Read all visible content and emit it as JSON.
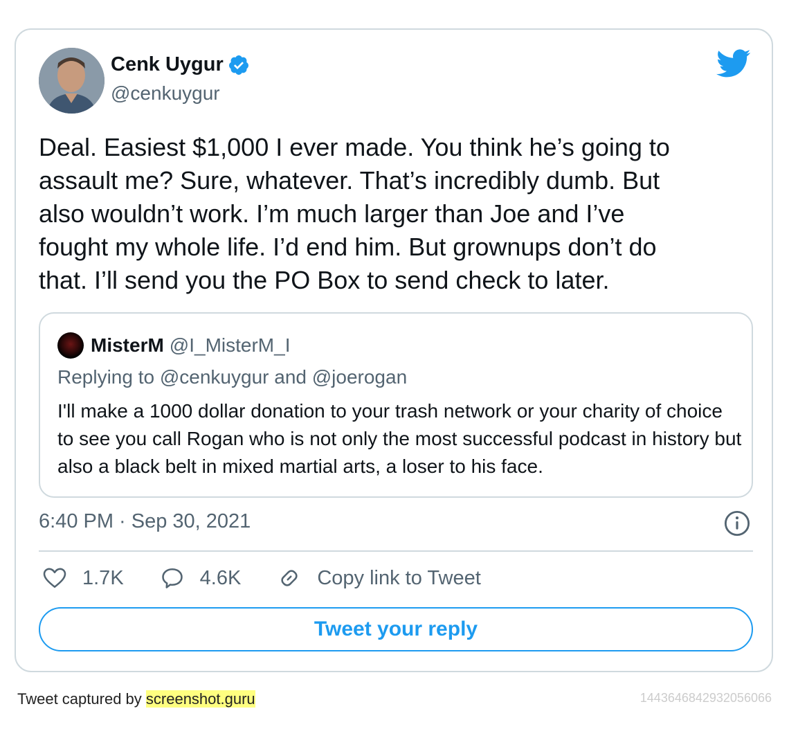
{
  "author": {
    "name": "Cenk Uygur",
    "handle": "@cenkuygur",
    "verified": true
  },
  "tweet": {
    "text": "Deal. Easiest $1,000 I ever made. You think he’s going to\nassault me? Sure, whatever. That’s incredibly dumb. But\nalso wouldn’t work. I’m much larger than Joe and I’ve\nfought my whole life. I’d end him. But grownups don’t do\nthat. I’ll send you the PO Box to send check to later.",
    "timestamp": "6:40 PM · Sep 30, 2021"
  },
  "quoted_tweet": {
    "name": "MisterM",
    "handle": "@I_MisterM_I",
    "replying_to": "Replying to @cenkuygur and @joerogan",
    "text": "I'll make a 1000 dollar donation to your trash network or your charity of choice to see you call Rogan who is not only the most successful podcast in history but also a black belt in mixed martial arts, a loser to his face."
  },
  "actions": {
    "likes": "1.7K",
    "replies": "4.6K",
    "copy_link": "Copy link to Tweet"
  },
  "reply_button": "Tweet your reply",
  "footer": {
    "prefix": "Tweet captured by ",
    "site": "screenshot.guru",
    "tweet_id": "1443646842932056066"
  },
  "icons": {
    "logo": "twitter-bird-icon",
    "verified": "verified-badge-icon",
    "info": "info-icon",
    "like": "heart-icon",
    "reply": "comment-bubble-icon",
    "link": "link-icon"
  },
  "colors": {
    "accent": "#1d9bf0",
    "border": "#cfd9de",
    "muted_text": "#536471",
    "highlight": "#ffff80"
  }
}
